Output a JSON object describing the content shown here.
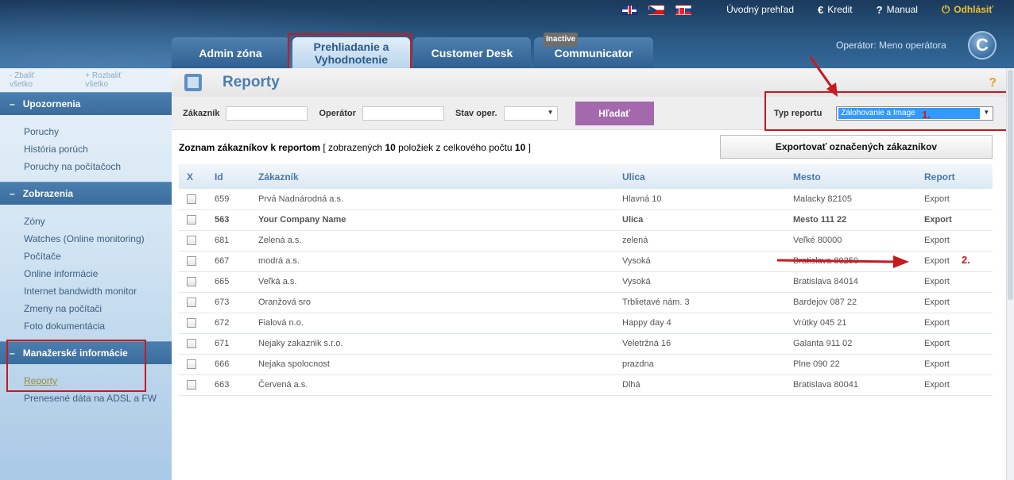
{
  "topbar": {
    "links": [
      {
        "label": "Úvodný prehľad",
        "icon": ""
      },
      {
        "label": "Kredit",
        "icon": "€"
      },
      {
        "label": "Manual",
        "icon": "?"
      },
      {
        "label": "Odhlásiť",
        "icon": "⏻"
      }
    ]
  },
  "tabs": [
    {
      "label_line1": "Admin zóna",
      "label_line2": "",
      "active": false
    },
    {
      "label_line1": "Prehliadanie a",
      "label_line2": "Vyhodnotenie",
      "active": true
    },
    {
      "label_line1": "Customer Desk",
      "label_line2": "",
      "active": false
    },
    {
      "label_line1": "Communicator",
      "label_line2": "",
      "active": false,
      "badge": "Inactive"
    }
  ],
  "operator": {
    "label": "Operátor:",
    "name": "Meno operátora"
  },
  "logo_letter": "C",
  "sidebar": {
    "collapse_all": "Zbaliť všetko",
    "expand_all": "Rozbaliť všetko",
    "sections": [
      {
        "title": "Upozornenia",
        "items": [
          "Poruchy",
          "História porúch",
          "Poruchy na počítačoch"
        ]
      },
      {
        "title": "Zobrazenia",
        "items": [
          "Zóny",
          "Watches (Online monitoring)",
          "Počítače",
          "Online informácie",
          "Internet bandwidth monitor",
          "Zmeny na počítači",
          "Foto dokumentácia"
        ]
      },
      {
        "title": "Manažerské informácie",
        "items": [
          "Reporty",
          "Prenesené dáta na ADSL a FW"
        ]
      }
    ]
  },
  "page": {
    "title": "Reporty",
    "help": "?"
  },
  "filter": {
    "zakaznik_label": "Zákazník",
    "operator_label": "Operátor",
    "stav_label": "Stav oper.",
    "search_button": "Hľadať",
    "typ_label": "Typ reportu",
    "typ_value": "Zálohovanie a Image"
  },
  "list": {
    "caption_bold": "Zoznam zákazníkov k reportom",
    "caption_pre": "[ zobrazených",
    "shown": "10",
    "caption_mid": "položiek z celkového počtu",
    "total": "10",
    "caption_end": "]",
    "export_button": "Exportovať označených zákazníkov",
    "columns": [
      "X",
      "Id",
      "Zákazník",
      "Ulica",
      "Mesto",
      "Report"
    ],
    "rows": [
      {
        "id": "659",
        "name": "Prvá Nadnárodná a.s.",
        "street": "Hlavná 10",
        "city": "Malacky 82105",
        "report": "Export",
        "bold": false
      },
      {
        "id": "563",
        "name": "Your Company Name",
        "street": "Ulica",
        "city": "Mesto 111 22",
        "report": "Export",
        "bold": true
      },
      {
        "id": "681",
        "name": "Zelená a.s.",
        "street": "zelená",
        "city": "Veľké 80000",
        "report": "Export",
        "bold": false
      },
      {
        "id": "667",
        "name": "modrá a.s.",
        "street": "Vysoká",
        "city": "Bratislava 80250",
        "report": "Export",
        "bold": false
      },
      {
        "id": "665",
        "name": "Veľká a.s.",
        "street": "Vysoká",
        "city": "Bratislava 84014",
        "report": "Export",
        "bold": false
      },
      {
        "id": "673",
        "name": "Oranžová sro",
        "street": "Trblietavé nám. 3",
        "city": "Bardejov 087 22",
        "report": "Export",
        "bold": false
      },
      {
        "id": "672",
        "name": "Fialová n.o.",
        "street": "Happy day 4",
        "city": "Vrútky 045 21",
        "report": "Export",
        "bold": false
      },
      {
        "id": "671",
        "name": "Nejaky zakaznik s.r.o.",
        "street": "Veletržná 16",
        "city": "Galanta 911 02",
        "report": "Export",
        "bold": false
      },
      {
        "id": "666",
        "name": "Nejaka spolocnost",
        "street": "prazdna",
        "city": "Plne 090 22",
        "report": "Export",
        "bold": false
      },
      {
        "id": "663",
        "name": "Červená a.s.",
        "street": "Dlhá",
        "city": "Bratislava 80041",
        "report": "Export",
        "bold": false
      }
    ]
  },
  "annotations": {
    "step1": "1.",
    "step2": "2."
  },
  "colors": {
    "accent": "#4b7db1",
    "button_search": "#a369ac",
    "annotation": "#c8191e",
    "link_gold": "#f0c030"
  }
}
